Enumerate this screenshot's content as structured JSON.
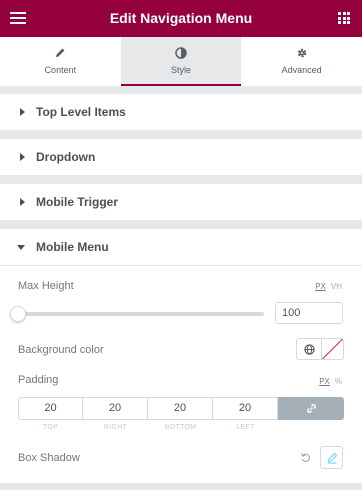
{
  "header": {
    "title": "Edit Navigation Menu"
  },
  "tabs": [
    {
      "label": "Content",
      "icon": "pencil-icon"
    },
    {
      "label": "Style",
      "icon": "contrast-icon",
      "active": true
    },
    {
      "label": "Advanced",
      "icon": "gear-icon"
    }
  ],
  "sections": [
    {
      "label": "Top Level Items",
      "open": false
    },
    {
      "label": "Dropdown",
      "open": false
    },
    {
      "label": "Mobile Trigger",
      "open": false
    },
    {
      "label": "Mobile Menu",
      "open": true
    }
  ],
  "mobile_menu": {
    "max_height": {
      "label": "Max Height",
      "units": [
        "PX",
        "VH"
      ],
      "active_unit": "PX",
      "value": "100"
    },
    "background_color": {
      "label": "Background color"
    },
    "padding": {
      "label": "Padding",
      "units": [
        "PX",
        "%"
      ],
      "active_unit": "PX",
      "values": [
        "20",
        "20",
        "20",
        "20"
      ],
      "sides": [
        "TOP",
        "RIGHT",
        "BOTTOM",
        "LEFT"
      ]
    },
    "box_shadow": {
      "label": "Box Shadow"
    }
  },
  "colors": {
    "accent": "#93003c",
    "text": "#495157",
    "muted": "#6d7882",
    "border": "#d5dadf",
    "background": "#e6e8ea"
  }
}
